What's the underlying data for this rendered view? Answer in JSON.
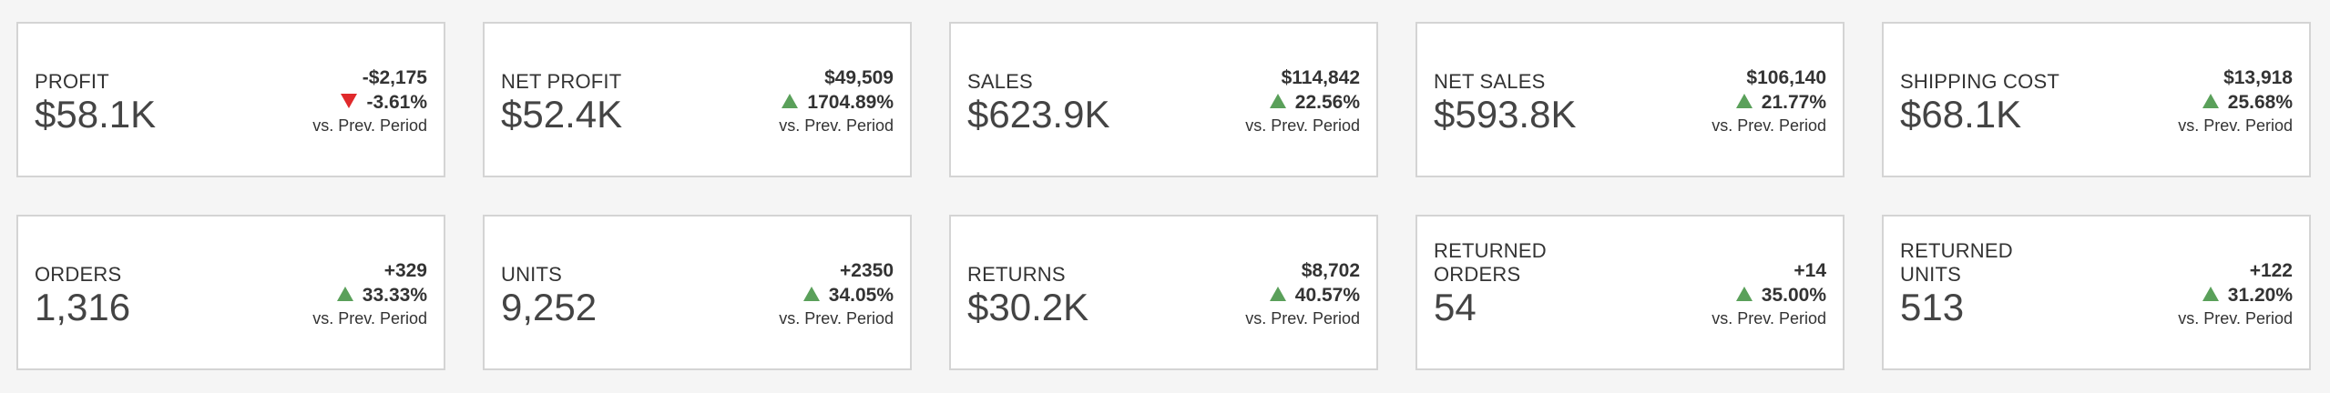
{
  "comparison_label": "vs. Prev. Period",
  "colors": {
    "up": "#5aa05a",
    "down": "#e0292b"
  },
  "cards": [
    {
      "label": "PROFIT",
      "value": "$58.1K",
      "delta": "-$2,175",
      "pct": "-3.61%",
      "trend": "down"
    },
    {
      "label": "NET PROFIT",
      "value": "$52.4K",
      "delta": "$49,509",
      "pct": "1704.89%",
      "trend": "up"
    },
    {
      "label": "SALES",
      "value": "$623.9K",
      "delta": "$114,842",
      "pct": "22.56%",
      "trend": "up"
    },
    {
      "label": "NET SALES",
      "value": "$593.8K",
      "delta": "$106,140",
      "pct": "21.77%",
      "trend": "up"
    },
    {
      "label": "SHIPPING COST",
      "value": "$68.1K",
      "delta": "$13,918",
      "pct": "25.68%",
      "trend": "up"
    },
    {
      "label": "ORDERS",
      "value": "1,316",
      "delta": "+329",
      "pct": "33.33%",
      "trend": "up"
    },
    {
      "label": "UNITS",
      "value": "9,252",
      "delta": "+2350",
      "pct": "34.05%",
      "trend": "up"
    },
    {
      "label": "RETURNS",
      "value": "$30.2K",
      "delta": "$8,702",
      "pct": "40.57%",
      "trend": "up"
    },
    {
      "label": "RETURNED ORDERS",
      "value": "54",
      "delta": "+14",
      "pct": "35.00%",
      "trend": "up"
    },
    {
      "label": "RETURNED UNITS",
      "value": "513",
      "delta": "+122",
      "pct": "31.20%",
      "trend": "up"
    }
  ]
}
